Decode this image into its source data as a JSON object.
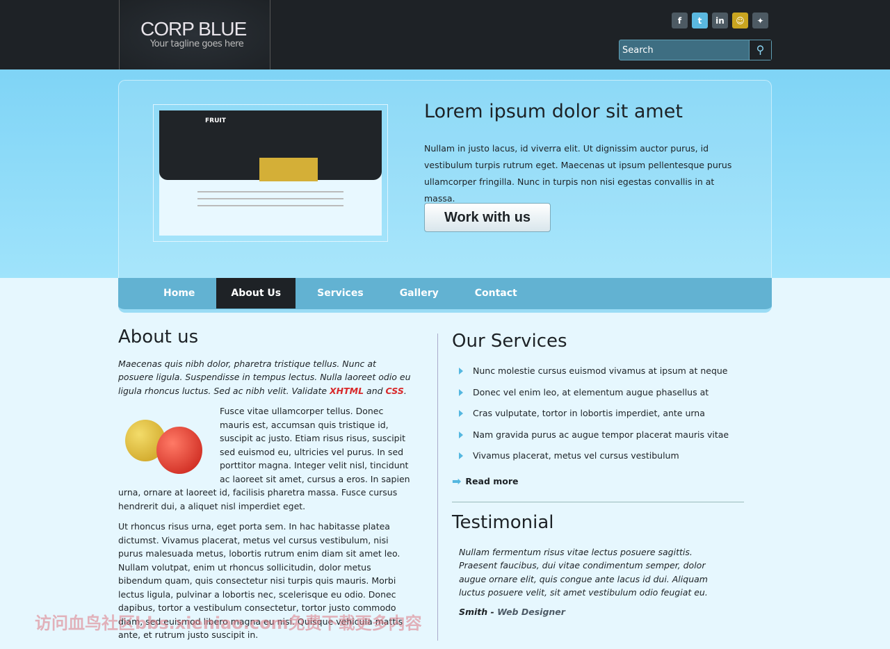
{
  "header": {
    "logo_title": "CORP BLUE",
    "tagline": "Your tagline goes here",
    "social": [
      {
        "icon": "facebook-icon",
        "glyph": "f"
      },
      {
        "icon": "twitter-icon",
        "glyph": "t"
      },
      {
        "icon": "linkedin-icon",
        "glyph": "in"
      },
      {
        "icon": "chat-icon",
        "glyph": "☺"
      },
      {
        "icon": "myspace-icon",
        "glyph": "✦"
      }
    ],
    "search_placeholder": "Search"
  },
  "hero": {
    "title": "Lorem ipsum dolor sit amet",
    "text": "Nullam in justo lacus, id viverra elit. Ut dignissim auctor purus, id vestibulum turpis rutrum eget. Maecenas ut ipsum pellentesque purus ullamcorper fringilla. Nunc in turpis non nisi egestas convallis in at massa.",
    "button": "Work with us",
    "screenshot_logo": "FRUIT"
  },
  "nav": [
    {
      "label": "Home"
    },
    {
      "label": "About Us",
      "active": true
    },
    {
      "label": "Services"
    },
    {
      "label": "Gallery"
    },
    {
      "label": "Contact"
    }
  ],
  "about": {
    "title": "About us",
    "intro": "Maecenas quis nibh dolor, pharetra tristique tellus. Nunc at posuere ligula. Suspendisse in tempus lectus. Nulla laoreet odio eu ligula rhoncus luctus. Sed ac nibh velit. Validate ",
    "xhtml": "XHTML",
    "and": " and ",
    "css": "CSS",
    "end": ".",
    "para1": "Fusce vitae ullamcorper tellus. Donec mauris est, accumsan quis tristique id, suscipit ac justo. Etiam risus risus, suscipit sed euismod eu, ultricies vel purus. In sed porttitor magna. Integer velit nisl, tincidunt ac laoreet sit amet, cursus a eros. In sapien urna, ornare at laoreet id, facilisis pharetra massa. Fusce cursus hendrerit dui, a aliquet nisl imperdiet eget.",
    "para2": "Ut rhoncus risus urna, eget porta sem. In hac habitasse platea dictumst. Vivamus placerat, metus vel cursus vestibulum, nisi purus malesuada metus, lobortis rutrum enim diam sit amet leo. Nullam volutpat, enim ut rhoncus sollicitudin, dolor metus bibendum quam, quis consectetur nisi turpis quis mauris. Morbi lectus ligula, pulvinar a lobortis nec, scelerisque eu odio. Donec dapibus, tortor a vestibulum consectetur, tortor justo commodo diam, sed euismod libero magna eu nisi. Quisque vehicula mattis ante, et rutrum justo suscipit in."
  },
  "services": {
    "title": "Our Services",
    "items": [
      "Nunc molestie cursus euismod vivamus at ipsum at neque",
      "Donec vel enim leo, at elementum augue phasellus at",
      "Cras vulputate, tortor in lobortis imperdiet, ante urna",
      "Nam gravida purus ac augue tempor placerat mauris vitae",
      "Vivamus placerat, metus vel cursus vestibulum"
    ],
    "read_more": "Read more"
  },
  "testimonial": {
    "title": "Testimonial",
    "quote": "Nullam fermentum risus vitae lectus posuere sagittis. Praesent faucibus, dui vitae condimentum semper, dolor augue ornare elit, quis congue ante lacus id dui. Aliquam luctus posuere velit, sit amet vestibulum odio feugiat eu.",
    "author": "Smith",
    "sep": " - ",
    "role": "Web Designer"
  },
  "watermark": "访问血鸟社区bbs.xieniao.com免费下载更多内容"
}
